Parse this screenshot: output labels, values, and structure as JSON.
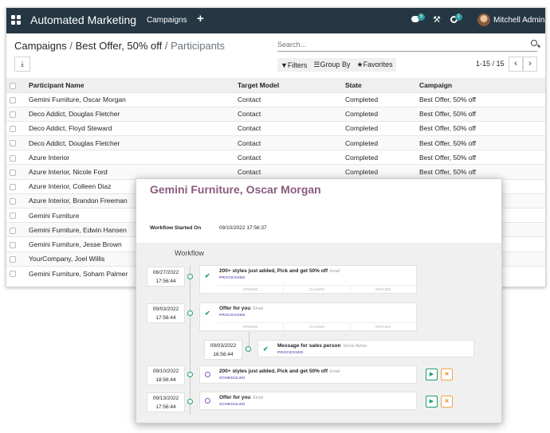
{
  "navbar": {
    "app_title": "Automated Marketing",
    "menu_campaigns": "Campaigns",
    "add_icon": "+",
    "messages_count": "5",
    "activities_count": "1",
    "user_name": "Mitchell Admin"
  },
  "breadcrumb": {
    "item1": "Campaigns",
    "item2": "Best Offer, 50% off",
    "current": "Participants"
  },
  "search": {
    "placeholder": "Search..."
  },
  "filters": {
    "filters_label": "Filters",
    "group_by_label": "Group By",
    "favorites_label": "Favorites"
  },
  "pager": {
    "value": "1-15 / 15"
  },
  "table": {
    "headers": [
      "Participant Name",
      "Target Model",
      "State",
      "Campaign"
    ],
    "rows": [
      [
        "Gemini Furniture, Oscar Morgan",
        "Contact",
        "Completed",
        "Best Offer, 50% off"
      ],
      [
        "Deco Addict, Douglas Fletcher",
        "Contact",
        "Completed",
        "Best Offer, 50% off"
      ],
      [
        "Deco Addict, Floyd Steward",
        "Contact",
        "Completed",
        "Best Offer, 50% off"
      ],
      [
        "Deco Addict, Douglas Fletcher",
        "Contact",
        "Completed",
        "Best Offer, 50% off"
      ],
      [
        "Azure Interior",
        "Contact",
        "Completed",
        "Best Offer, 50% off"
      ],
      [
        "Azure Interior, Nicole Ford",
        "Contact",
        "Completed",
        "Best Offer, 50% off"
      ],
      [
        "Azure Interior, Colleen Diaz",
        "",
        "",
        ""
      ],
      [
        "Azure Interior, Brandon Freeman",
        "",
        "",
        ""
      ],
      [
        "Gemini Furniture",
        "",
        "",
        ""
      ],
      [
        "Gemini Furniture, Edwin Hansen",
        "",
        "",
        ""
      ],
      [
        "Gemini Furniture, Jesse Brown",
        "",
        "",
        ""
      ],
      [
        "YourCompany, Joel Willis",
        "",
        "",
        ""
      ],
      [
        "Gemini Furniture, Soham Palmer",
        "",
        "",
        ""
      ]
    ]
  },
  "overlay": {
    "title": "Gemini Furniture, Oscar Morgan",
    "workflow_started_label": "Workflow Started On",
    "workflow_started_value": "09/10/2022 17:56:37",
    "workflow_title": "Workflow",
    "activities": [
      {
        "date": "08/27/2022",
        "time": "17:56:44",
        "name": "200+ styles just added, Pick and get 50% off",
        "type": "Email",
        "status": "PROCESSED",
        "metrics": [
          "OPENED",
          "CLICKED",
          "REPLIED"
        ]
      },
      {
        "date": "09/03/2022",
        "time": "17:56:44",
        "name": "Offer for you",
        "type": "Email",
        "status": "PROCESSED",
        "metrics": [
          "OPENED",
          "CLICKED",
          "REPLIED"
        ]
      },
      {
        "date": "09/03/2022",
        "time": "16:56:44",
        "name": "Message for sales person",
        "type": "Server Action",
        "status": "PROCESSED"
      },
      {
        "date": "09/10/2022",
        "time": "18:56:44",
        "name": "200+ styles just added, Pick and get 50% off",
        "type": "Email",
        "status": "SCHEDULED"
      },
      {
        "date": "09/13/2022",
        "time": "17:56:44",
        "name": "Offer for you",
        "type": "Email",
        "status": "SCHEDULED"
      }
    ]
  }
}
